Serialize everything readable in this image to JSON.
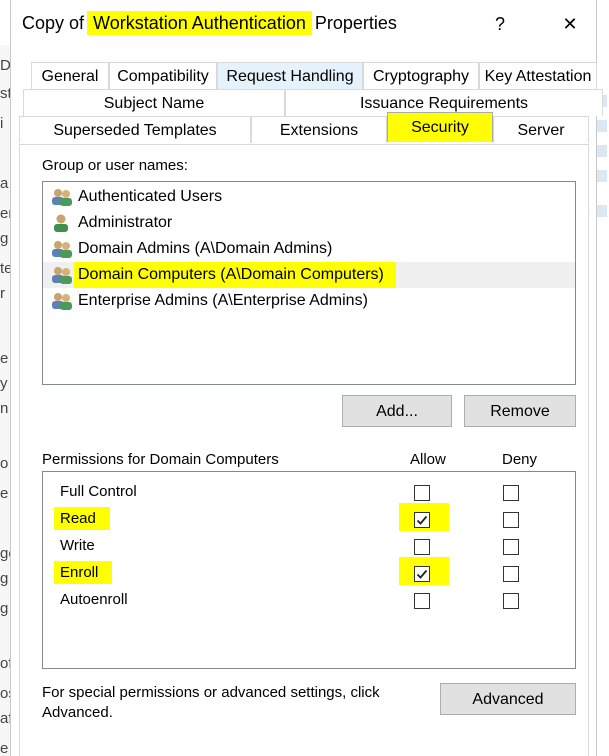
{
  "window": {
    "title_prefix": "Copy of ",
    "title_highlight": "Workstation Authentication",
    "title_suffix": " Properties",
    "help_glyph": "?",
    "close_glyph": "✕"
  },
  "tabs": {
    "row1": [
      "General",
      "Compatibility",
      "Request Handling",
      "Cryptography",
      "Key Attestation"
    ],
    "row2": [
      "Subject Name",
      "Issuance Requirements"
    ],
    "row3": [
      "Superseded Templates",
      "Extensions",
      "Security",
      "Server"
    ],
    "selected": "Security"
  },
  "security": {
    "group_label": "Group or user names:",
    "users": [
      {
        "name": "Authenticated Users",
        "icon": "group-icon"
      },
      {
        "name": "Administrator",
        "icon": "user-icon"
      },
      {
        "name": "Domain Admins (A\\Domain Admins)",
        "icon": "group-icon"
      },
      {
        "name": "Domain Computers (A\\Domain Computers)",
        "icon": "group-icon"
      },
      {
        "name": "Enterprise Admins (A\\Enterprise Admins)",
        "icon": "group-icon"
      }
    ],
    "selected_user": "Domain Computers (A\\Domain Computers)",
    "add_label": "Add...",
    "remove_label": "Remove",
    "permissions_label": "Permissions for Domain Computers",
    "allow_header": "Allow",
    "deny_header": "Deny",
    "permissions": [
      {
        "name": "Full Control",
        "allow": false,
        "deny": false
      },
      {
        "name": "Read",
        "allow": true,
        "deny": false
      },
      {
        "name": "Write",
        "allow": false,
        "deny": false
      },
      {
        "name": "Enroll",
        "allow": true,
        "deny": false
      },
      {
        "name": "Autoenroll",
        "allow": false,
        "deny": false
      }
    ],
    "advanced_text": "For special permissions or advanced settings, click Advanced.",
    "advanced_label": "Advanced"
  },
  "colors": {
    "highlight": "#ffff00",
    "request_handling_tab": "#e5f1fb"
  }
}
